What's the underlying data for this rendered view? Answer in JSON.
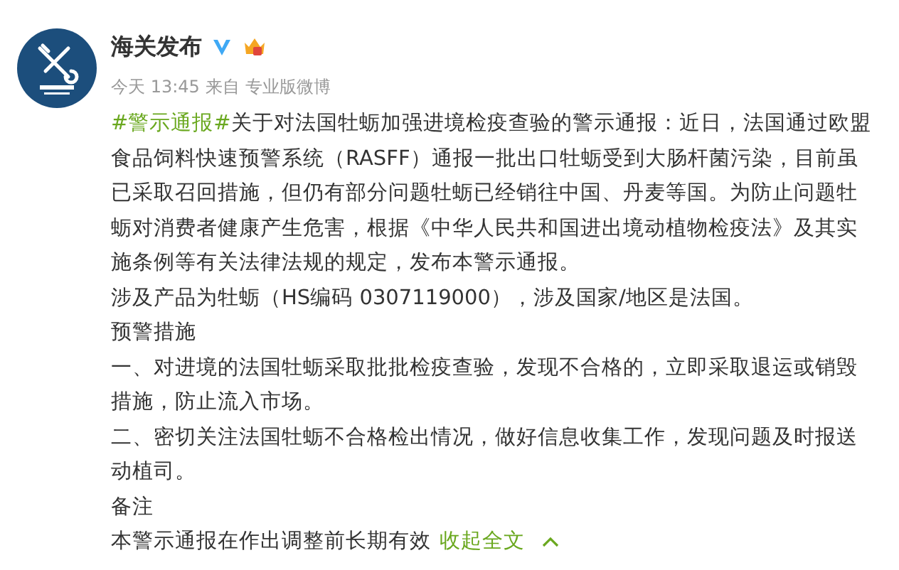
{
  "post": {
    "author": "海关发布",
    "time": "今天 13:45",
    "source_prefix": "来自",
    "source": "专业版微博",
    "hashtag": "#警示通报#",
    "paragraphs": [
      "关于对法国牡蛎加强进境检疫查验的警示通报：近日，法国通过欧盟食品饲料快速预警系统（RASFF）通报一批出口牡蛎受到大肠杆菌污染，目前虽已采取召回措施，但仍有部分问题牡蛎已经销往中国、丹麦等国。为防止问题牡蛎对消费者健康产生危害，根据《中华人民共和国进出境动植物检疫法》及其实施条例等有关法律法规的规定，发布本警示通报。",
      "涉及产品为牡蛎（HS编码 0307119000），涉及国家/地区是法国。",
      "预警措施",
      "一、对进境的法国牡蛎采取批批检疫查验，发现不合格的，立即采取退运或销毁措施，防止流入市场。",
      "二、密切关注法国牡蛎不合格检出情况，做好信息收集工作，发现问题及时报送动植司。",
      "备注",
      "本警示通报在作出调整前长期有效"
    ],
    "collapse_link": "收起全文",
    "expanded": true
  }
}
